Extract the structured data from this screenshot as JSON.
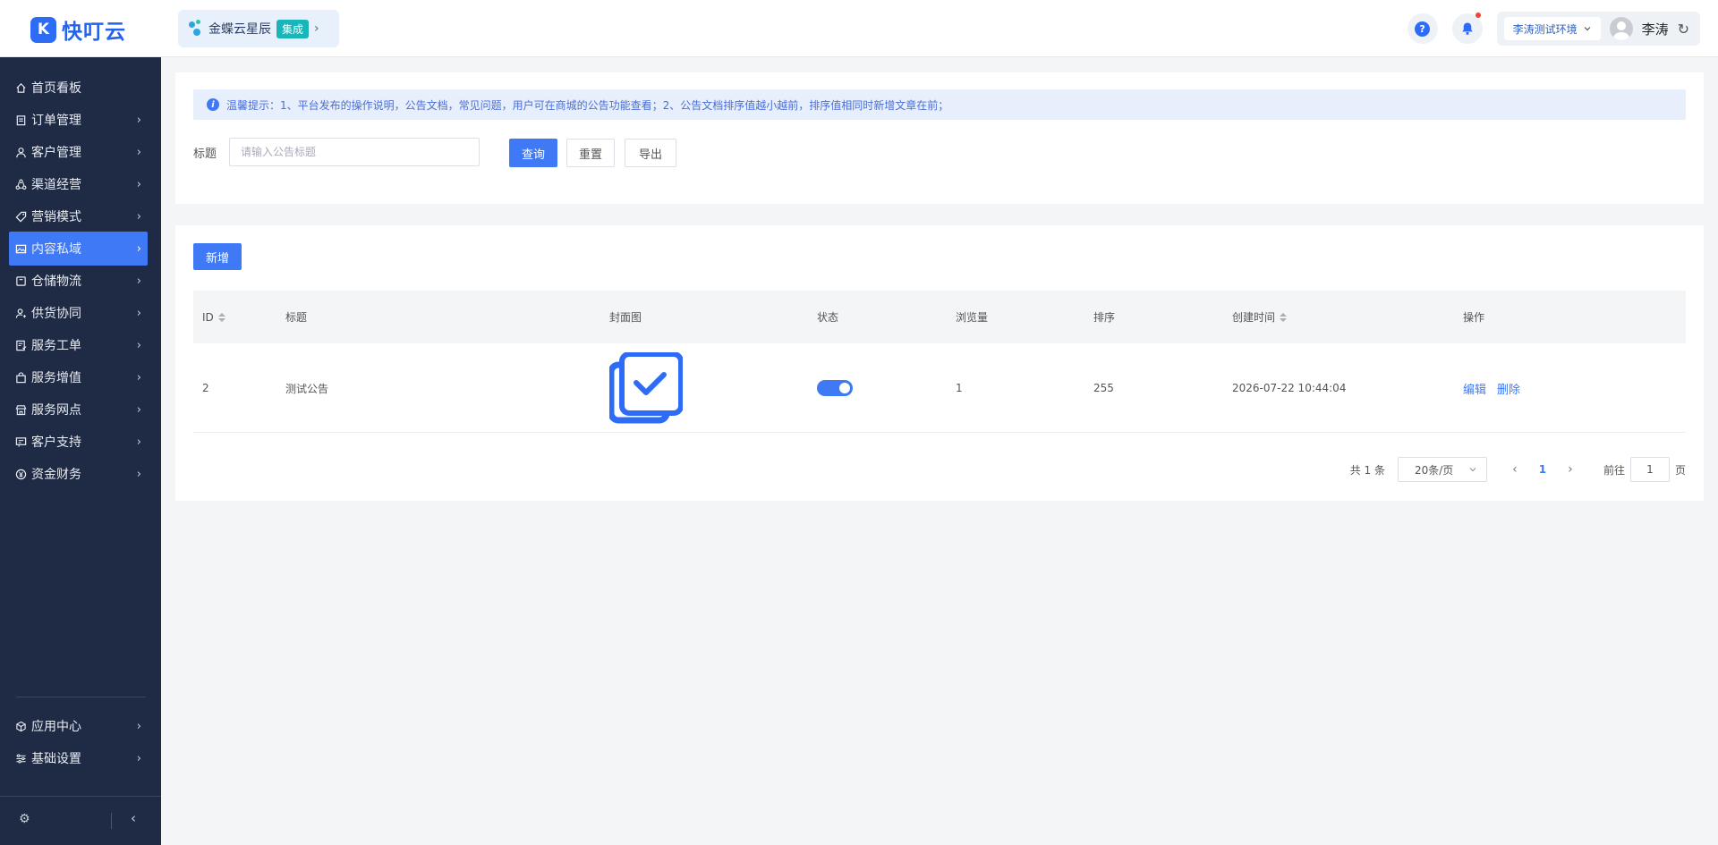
{
  "brand": {
    "logo_mark": "K",
    "name": "快叮云",
    "brand_color": "#2e6cf6"
  },
  "integration": {
    "name": "金蝶云星辰",
    "tag": "集成"
  },
  "header": {
    "env_label": "李涛测试环境",
    "username": "李涛"
  },
  "sidebar": {
    "items": [
      {
        "label": "首页看板",
        "icon": "home-icon"
      },
      {
        "label": "订单管理",
        "icon": "clipboard-icon"
      },
      {
        "label": "客户管理",
        "icon": "user-icon"
      },
      {
        "label": "渠道经营",
        "icon": "channel-icon"
      },
      {
        "label": "营销模式",
        "icon": "tag-icon"
      },
      {
        "label": "内容私域",
        "icon": "image-icon",
        "active": true
      },
      {
        "label": "仓储物流",
        "icon": "box-icon"
      },
      {
        "label": "供货协同",
        "icon": "supply-user-icon"
      },
      {
        "label": "服务工单",
        "icon": "ticket-icon"
      },
      {
        "label": "服务增值",
        "icon": "bag-icon"
      },
      {
        "label": "服务网点",
        "icon": "store-icon"
      },
      {
        "label": "客户支持",
        "icon": "support-icon"
      },
      {
        "label": "资金财务",
        "icon": "yen-icon"
      }
    ],
    "bottom_items": [
      {
        "label": "应用中心",
        "icon": "cube-icon"
      },
      {
        "label": "基础设置",
        "icon": "settings-list-icon"
      }
    ]
  },
  "notice": {
    "text": "温馨提示：1、平台发布的操作说明，公告文档，常见问题，用户可在商城的公告功能查看；2、公告文档排序值越小越前，排序值相同时新增文章在前；"
  },
  "search": {
    "title_label": "标题",
    "title_placeholder": "请输入公告标题",
    "title_value": "",
    "query_label": "查询",
    "reset_label": "重置",
    "export_label": "导出"
  },
  "table": {
    "add_label": "新增",
    "columns": [
      "ID",
      "标题",
      "封面图",
      "状态",
      "浏览量",
      "排序",
      "创建时间",
      "操作"
    ],
    "rows": [
      {
        "id": "2",
        "title": "测试公告",
        "status_on": true,
        "views": "1",
        "sort": "255",
        "created_at": "2026-07-22 10:44:04",
        "edit": "编辑",
        "delete": "删除"
      }
    ]
  },
  "pagination": {
    "total_prefix": "共 1 条",
    "page_size": "20条/页",
    "current_page": "1",
    "goto_label": "前往",
    "goto_value": "1",
    "page_suffix": "页"
  },
  "colors": {
    "accent": "#3f79f5",
    "sidebar_bg": "#1f2a44",
    "notice_bg": "#e8effc"
  }
}
